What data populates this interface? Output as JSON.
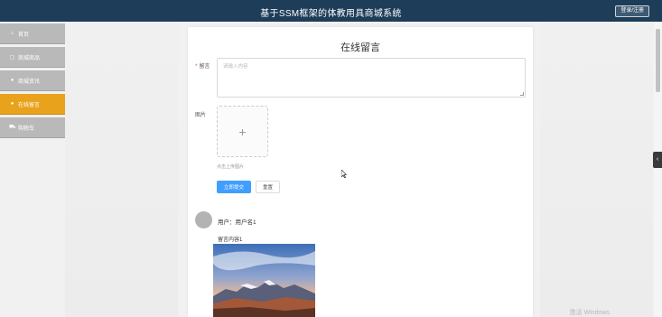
{
  "header": {
    "title": "基于SSM框架的体教用具商城系统",
    "login_label": "登录/注册"
  },
  "sidebar": {
    "items": [
      {
        "icon": "home-icon",
        "label": "首页",
        "active": false
      },
      {
        "icon": "shop-icon",
        "label": "商城商品",
        "active": false
      },
      {
        "icon": "info-icon",
        "label": "商城资讯",
        "active": false
      },
      {
        "icon": "message-icon",
        "label": "在线留言",
        "active": true
      },
      {
        "icon": "cart-icon",
        "label": "购物车",
        "active": false
      }
    ]
  },
  "form": {
    "title": "在线留言",
    "message_label": "留言",
    "required_mark": "*",
    "message_placeholder": "请输入内容",
    "image_label": "图片",
    "upload_tip": "点击上传图片",
    "submit_label": "立即提交",
    "reset_label": "重置"
  },
  "messages": [
    {
      "user": "用户：用户名1",
      "content": "留言内容1"
    }
  ],
  "watermark": "激活 Windows",
  "colors": {
    "header_bg": "#1d3d58",
    "active_nav": "#e9a21c",
    "nav_bg": "#b9b9b9",
    "primary": "#409eff"
  }
}
